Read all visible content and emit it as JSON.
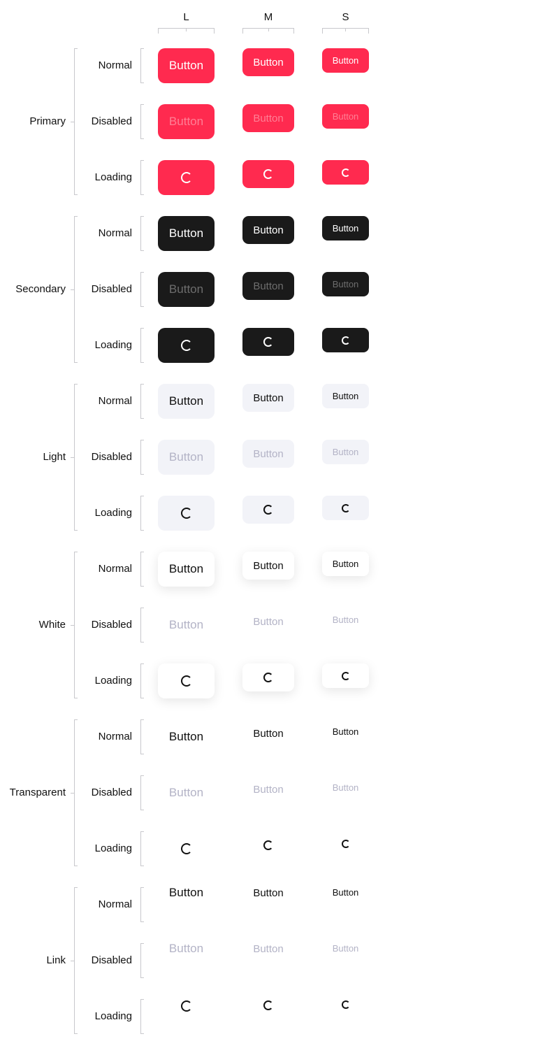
{
  "sizes": [
    "L",
    "M",
    "S"
  ],
  "groups": [
    {
      "name": "Primary",
      "states": [
        {
          "label": "Normal",
          "text": "Button"
        },
        {
          "label": "Disabled",
          "text": "Button"
        },
        {
          "label": "Loading",
          "text": ""
        }
      ]
    },
    {
      "name": "Secondary",
      "states": [
        {
          "label": "Normal",
          "text": "Button"
        },
        {
          "label": "Disabled",
          "text": "Button"
        },
        {
          "label": "Loading",
          "text": ""
        }
      ]
    },
    {
      "name": "Light",
      "states": [
        {
          "label": "Normal",
          "text": "Button"
        },
        {
          "label": "Disabled",
          "text": "Button"
        },
        {
          "label": "Loading",
          "text": ""
        }
      ]
    },
    {
      "name": "White",
      "states": [
        {
          "label": "Normal",
          "text": "Button"
        },
        {
          "label": "Disabled",
          "text": "Button"
        },
        {
          "label": "Loading",
          "text": ""
        }
      ]
    },
    {
      "name": "Transparent",
      "states": [
        {
          "label": "Normal",
          "text": "Button"
        },
        {
          "label": "Disabled",
          "text": "Button"
        },
        {
          "label": "Loading",
          "text": ""
        }
      ]
    },
    {
      "name": "Link",
      "states": [
        {
          "label": "Normal",
          "text": "Button"
        },
        {
          "label": "Disabled",
          "text": "Button"
        },
        {
          "label": "Loading",
          "text": ""
        }
      ]
    }
  ],
  "colors": {
    "primary": "#ff2a4f",
    "secondary": "#1a1a1a",
    "light": "#f2f3f8",
    "white": "#ffffff",
    "disabled_text": "#b3b3c6",
    "bracket": "#c8c8cc"
  },
  "icons": {
    "loading": "spinner-icon"
  }
}
